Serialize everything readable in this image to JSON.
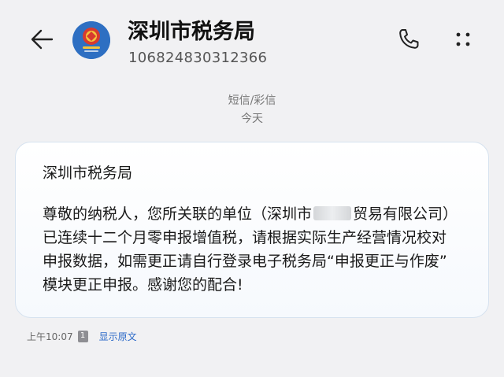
{
  "header": {
    "sender_name": "深圳市税务局",
    "sender_number": "106824830312366",
    "icons": {
      "back": "arrow-left-icon",
      "call": "phone-icon",
      "more": "more-vertical-icon"
    }
  },
  "meta": {
    "message_type": "短信/彩信",
    "date": "今天"
  },
  "message": {
    "title": "深圳市税务局",
    "lines_before_redaction": "尊敬的纳税人，您所关联的单位（深圳市",
    "lines_after_redaction": "贸易有限公司）",
    "line2": "已连续十二个月零申报增值税，请根据实际生产经营情况校对",
    "line3": "申报数据，如需更正请自行登录电子税务局“申报更正与作废”",
    "line4": "模块更正申报。感谢您的配合!"
  },
  "footer": {
    "time": "上午10:07",
    "sim": "1",
    "show_original": "显示原文"
  },
  "colors": {
    "accent": "#2f6cc9",
    "background": "#f1f1f3",
    "bubble_border": "#d6e2ef"
  }
}
